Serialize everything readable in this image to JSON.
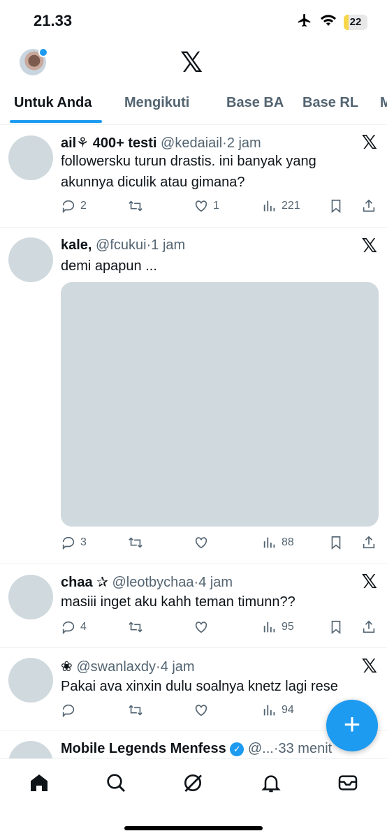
{
  "status_bar": {
    "time": "21.33",
    "battery": "22",
    "battery_level": 0.22
  },
  "header": {
    "logo": "𝕏"
  },
  "tabs": [
    {
      "label": "Untuk Anda",
      "active": true
    },
    {
      "label": "Mengikuti"
    },
    {
      "label": "Base BA"
    },
    {
      "label": "Base RL"
    },
    {
      "label": "M"
    }
  ],
  "posts": [
    {
      "name": "ail⚘ 400+ testi",
      "handle": "@kedaiail",
      "time": "2 jam",
      "text": "followersku turun drastis. ini banyak yang akunnya diculik atau gimana?",
      "replies": "2",
      "retweets": "",
      "likes": "1",
      "views": "221"
    },
    {
      "name": "kale,",
      "handle": "@fcukui",
      "time": "1 jam",
      "text": "demi apapun ...",
      "replies": "3",
      "retweets": "",
      "likes": "",
      "views": "88"
    },
    {
      "name": "chaa ✰",
      "handle": "@leotbychaa",
      "time": "4 jam",
      "text": "masiii inget aku kahh teman timunn??",
      "replies": "4",
      "retweets": "",
      "likes": "",
      "views": "95"
    },
    {
      "name": "❀",
      "handle": "@swanlaxdy",
      "time": "4 jam",
      "text": "Pakai ava xinxin dulu soalnya knetz lagi rese",
      "replies": "",
      "retweets": "",
      "likes": "",
      "views": "94"
    },
    {
      "name": "Mobile Legends Menfess",
      "handle": "@...",
      "time": "33 menit"
    }
  ],
  "fab": {
    "label": "+"
  },
  "colors": {
    "accent": "#1d9bf0",
    "text": "#0f1419",
    "muted": "#536471",
    "placeholder": "#cfd9de"
  },
  "icons": [
    "home-icon",
    "search-icon",
    "grok-icon",
    "bell-icon",
    "mail-icon"
  ]
}
